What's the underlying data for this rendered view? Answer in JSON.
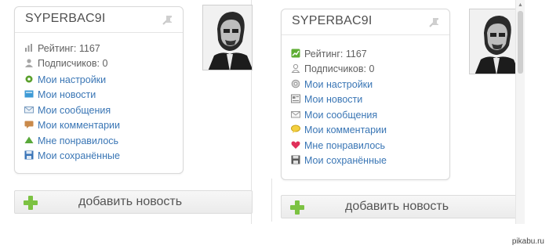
{
  "left_panel": {
    "username": "SYPERBAC9I",
    "rating": "Рейтинг: 1167",
    "subscribers": "Подписчиков: 0",
    "menu": [
      {
        "label": "Мои настройки",
        "icon": "gear-icon"
      },
      {
        "label": "Мои новости",
        "icon": "news-icon"
      },
      {
        "label": "Мои сообщения",
        "icon": "envelope-icon"
      },
      {
        "label": "Мои комментарии",
        "icon": "comment-icon"
      },
      {
        "label": "Мне понравилось",
        "icon": "thumb-up-icon"
      },
      {
        "label": "Мои сохранённые",
        "icon": "floppy-icon"
      }
    ],
    "add_news": "добавить новость"
  },
  "right_panel": {
    "username": "SYPERBAC9I",
    "rating": "Рейтинг: 1167",
    "subscribers": "Подписчиков: 0",
    "menu": [
      {
        "label": "Мои настройки",
        "icon": "gear-icon"
      },
      {
        "label": "Мои новости",
        "icon": "news-icon"
      },
      {
        "label": "Мои сообщения",
        "icon": "envelope-icon"
      },
      {
        "label": "Мои комментарии",
        "icon": "comment-icon"
      },
      {
        "label": "Мне понравилось",
        "icon": "heart-icon"
      },
      {
        "label": "Мои сохранённые",
        "icon": "floppy-icon"
      }
    ],
    "add_news": "добавить новость"
  },
  "watermark": "pikabu.ru",
  "colors": {
    "link": "#3a76b5",
    "plus": "#7cc242",
    "heart": "#e0305a"
  }
}
